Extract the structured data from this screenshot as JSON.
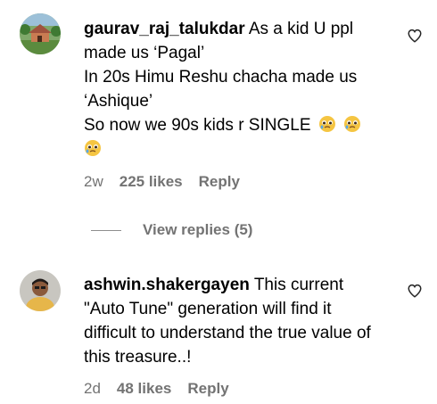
{
  "comments": [
    {
      "username": "gaurav_raj_talukdar",
      "lines": [
        "As a kid U ppl made us ‘Pagal’",
        "In 20s Himu Reshu chacha made us ‘Ashique’",
        "So now we 90s kids r SINGLE"
      ],
      "emoji": "pleading-tear-face",
      "time": "2w",
      "likes": "225 likes",
      "reply": "Reply"
    },
    {
      "username": "ashwin.shakergayen",
      "lines": [
        "This current \"Auto Tune\" generation will find it difficult to understand the true value of this treasure..!"
      ],
      "time": "2d",
      "likes": "48 likes",
      "reply": "Reply"
    }
  ],
  "view_replies": "View replies (5)",
  "icons": {
    "like": "heart-outline-icon",
    "emoji": "pleading-tear-face-emoji"
  },
  "colors": {
    "meta": "#737373",
    "emoji": "#f5c542"
  }
}
